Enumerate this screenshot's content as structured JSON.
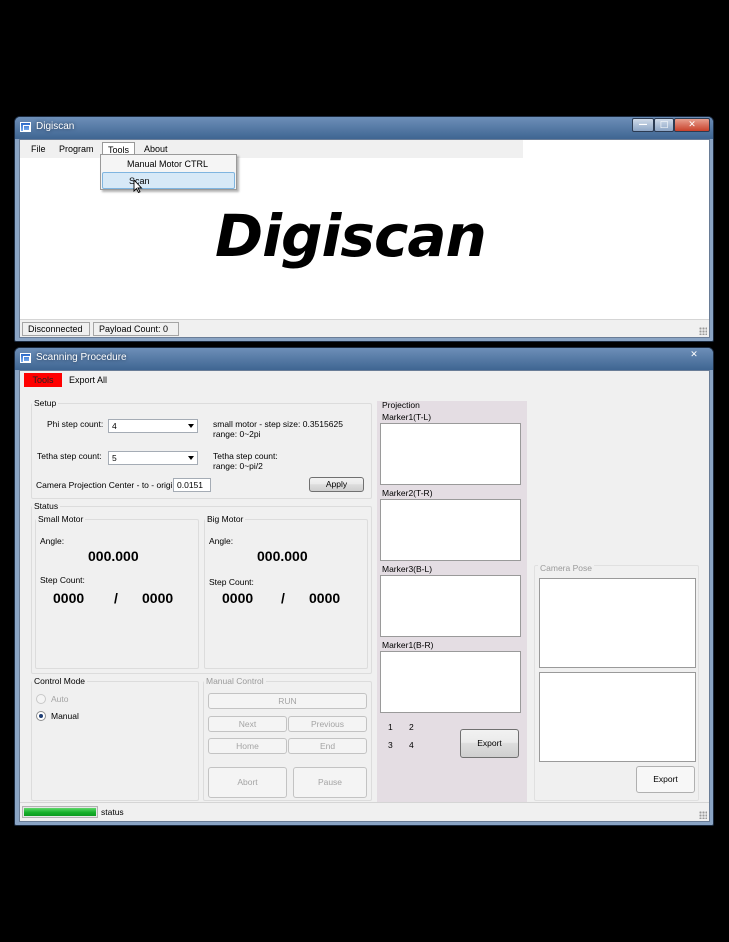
{
  "digiscan_window": {
    "title": "Digiscan",
    "controls": {
      "minimize": "—",
      "maximize": "□",
      "close": "✕"
    },
    "menu": [
      "File",
      "Program",
      "Tools",
      "About"
    ],
    "tools_menu": {
      "items": [
        "Manual Motor CTRL",
        "Scan"
      ],
      "highlighted": "Scan"
    },
    "logo": "Digiscan",
    "status": {
      "connection": "Disconnected",
      "payload": "Payload Count:  0"
    }
  },
  "scan_window": {
    "title": "Scanning Procedure",
    "close": "✕",
    "menu": {
      "tools": "Tools",
      "export_all": "Export All",
      "tools_color": "#ff0000"
    },
    "setup": {
      "title": "Setup",
      "phi_label": "Phi step count:",
      "phi_value": "4",
      "phi_info_1": "small motor - step size: 0.3515625",
      "phi_info_2": "range: 0~2pi",
      "tetha_label": "Tetha step count:",
      "tetha_value": "5",
      "tetha_info_1": "Tetha step count:",
      "tetha_info_2": "range: 0~pi/2",
      "camera_label": "Camera Projection Center - to - origin",
      "camera_value": "0.0151",
      "apply": "Apply"
    },
    "status": {
      "title": "Status",
      "small_motor": {
        "title": "Small Motor",
        "angle_label": "Angle:",
        "angle": "000.000",
        "step_label": "Step Count:",
        "step_a": "0000",
        "sep": "/",
        "step_b": "0000"
      },
      "big_motor": {
        "title": "Big Motor",
        "angle_label": "Angle:",
        "angle": "000.000",
        "step_label": "Step Count:",
        "step_a": "0000",
        "sep": "/",
        "step_b": "0000"
      }
    },
    "control_mode": {
      "title": "Control Mode",
      "auto": "Auto",
      "manual": "Manual",
      "selected": "Manual"
    },
    "manual_control": {
      "title": "Manual Control",
      "run": "RUN",
      "next": "Next",
      "previous": "Previous",
      "home": "Home",
      "end": "End",
      "abort": "Abort",
      "pause": "Pause"
    },
    "projection": {
      "title": "Projection",
      "markers": [
        "Marker1(T-L)",
        "Marker2(T-R)",
        "Marker3(B-L)",
        "Marker1(B-R)"
      ],
      "nums": [
        "1",
        "2",
        "3",
        "4"
      ],
      "export": "Export"
    },
    "camera_pose": {
      "title": "Camera Pose",
      "export": "Export"
    },
    "statusbar": {
      "progress": 1.0,
      "text": "status"
    }
  }
}
